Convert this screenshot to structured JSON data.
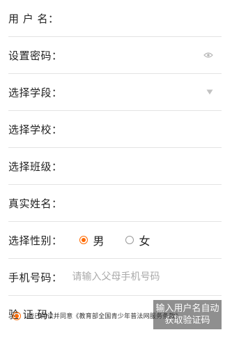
{
  "form": {
    "username_label": "用 户 名：",
    "password_label": "设置密码：",
    "stage_label": "选择学段：",
    "school_label": "选择学校：",
    "class_label": "选择班级：",
    "realname_label": "真实姓名：",
    "gender_label": "选择性别：",
    "gender_options": [
      "男",
      "女"
    ],
    "gender_selected": "男",
    "phone_label": "手机号码：",
    "phone_placeholder": "请输入父母手机号码",
    "captcha_label": "验 证 码：",
    "captcha_button_lines": [
      "输入用户名自动",
      "获取验证码"
    ],
    "agreement_text": "我已阅读并同意《教育部全国青少年普法网服务条款》"
  },
  "colors": {
    "accent": "#ff6a00",
    "button_bg": "#8f8f8f",
    "divider": "#e3e3e3"
  },
  "icons": {
    "password_toggle": "eye-icon",
    "stage_dropdown": "triangle-down-icon",
    "agree_check": "radio-checked-icon"
  }
}
